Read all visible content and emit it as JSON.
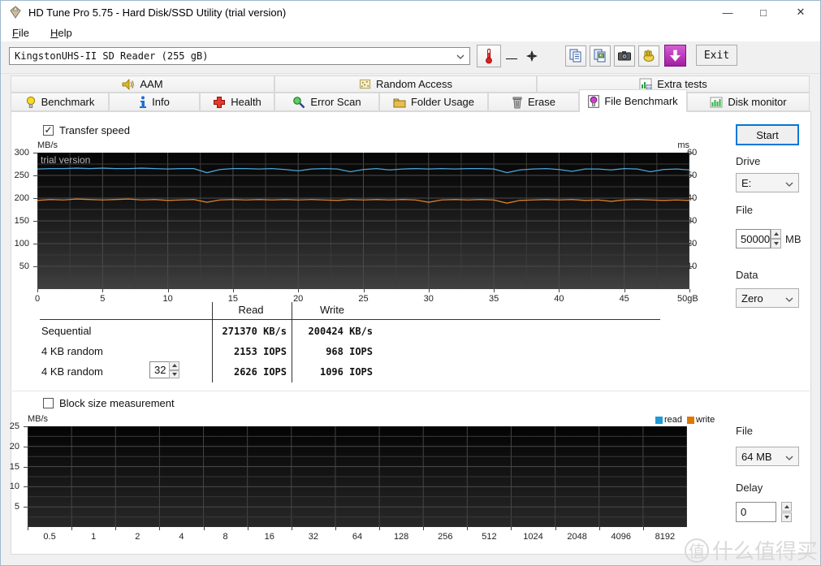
{
  "window": {
    "title": "HD Tune Pro 5.75 - Hard Disk/SSD Utility (trial version)",
    "controls": {
      "minimize": "—",
      "maximize": "□",
      "close": "✕"
    }
  },
  "menu": {
    "items": [
      {
        "label": "File"
      },
      {
        "label": "Help"
      }
    ]
  },
  "toolbar": {
    "device_select": "KingstonUHS-II SD Reader (255 gB)",
    "temperature_value": "—",
    "exit_label": "Exit"
  },
  "tabs": {
    "row1": [
      "AAM",
      "Random Access",
      "Extra tests"
    ],
    "row2": [
      "Benchmark",
      "Info",
      "Health",
      "Error Scan",
      "Folder Usage",
      "Erase",
      "File Benchmark",
      "Disk monitor"
    ],
    "selected": "File Benchmark"
  },
  "panel": {
    "transfer_speed": {
      "label": "Transfer speed",
      "checked": true
    },
    "block_size": {
      "label": "Block size measurement",
      "checked": false
    },
    "results": {
      "columns": [
        "Read",
        "Write"
      ],
      "rows": [
        {
          "label": "Sequential",
          "read": "271370 KB/s",
          "write": "200424 KB/s"
        },
        {
          "label": "4 KB random",
          "read": "2153 IOPS",
          "write": "968 IOPS"
        },
        {
          "label": "4 KB random",
          "queue_depth": "32",
          "read": "2626 IOPS",
          "write": "1096 IOPS"
        }
      ]
    },
    "legend": [
      {
        "label": "read",
        "color": "#1f9ad6"
      },
      {
        "label": "write",
        "color": "#e07800"
      }
    ]
  },
  "sidebar": {
    "start_label": "Start",
    "drive_label": "Drive",
    "drive_value": "E:",
    "file_label": "File",
    "file_size_value": "50000",
    "file_size_unit": "MB",
    "data_label": "Data",
    "data_value": "Zero",
    "file2_label": "File",
    "file2_value": "64 MB",
    "delay_label": "Delay",
    "delay_value": "0"
  },
  "watermark": {
    "badge": "值",
    "text": "什么值得买"
  },
  "chart_data": [
    {
      "type": "line",
      "title": "Transfer speed",
      "annotation": "trial version",
      "ylabel_left": "MB/s",
      "y_ticks_left": [
        300,
        250,
        200,
        150,
        100,
        50
      ],
      "ylabel_right": "ms",
      "y_ticks_right": [
        60,
        50,
        40,
        30,
        20,
        10
      ],
      "ylim_left": [
        0,
        300
      ],
      "ylim_right": [
        0,
        60
      ],
      "x_ticks": [
        "0",
        "5",
        "10",
        "15",
        "20",
        "25",
        "30",
        "35",
        "40",
        "45",
        "50gB"
      ],
      "x_range_gb": [
        0,
        50
      ],
      "grid": true,
      "series": [
        {
          "name": "read",
          "color": "#4aa6dc",
          "unit": "MB/s",
          "values": [
            264,
            265,
            265,
            266,
            265,
            266,
            265,
            265,
            266,
            265,
            264,
            265,
            265,
            256,
            263,
            265,
            265,
            264,
            265,
            263,
            260,
            264,
            265,
            264,
            258,
            263,
            265,
            262,
            264,
            265,
            264,
            265,
            264,
            265,
            265,
            264,
            256,
            262,
            264,
            265,
            263,
            259,
            264,
            264,
            262,
            265,
            264,
            258,
            263,
            264,
            262
          ]
        },
        {
          "name": "write",
          "color": "#dc7f28",
          "unit": "MB/s",
          "values": [
            195,
            197,
            196,
            198,
            197,
            196,
            197,
            198,
            196,
            197,
            195,
            196,
            197,
            191,
            196,
            197,
            196,
            197,
            196,
            197,
            196,
            197,
            196,
            195,
            197,
            196,
            197,
            196,
            197,
            196,
            191,
            196,
            197,
            196,
            197,
            196,
            189,
            195,
            196,
            197,
            196,
            197,
            195,
            196,
            193,
            196,
            197,
            196,
            195,
            196,
            195
          ]
        }
      ]
    },
    {
      "type": "line",
      "title": "Block size measurement",
      "ylabel": "MB/s",
      "y_ticks": [
        25,
        20,
        15,
        10,
        5
      ],
      "ylim": [
        0,
        25
      ],
      "x_ticks": [
        "0.5",
        "1",
        "2",
        "4",
        "8",
        "16",
        "32",
        "64",
        "128",
        "256",
        "512",
        "1024",
        "2048",
        "4096",
        "8192"
      ],
      "grid": true,
      "legend_position": "top-right",
      "series": [
        {
          "name": "read",
          "color": "#1f9ad6",
          "values": []
        },
        {
          "name": "write",
          "color": "#e07800",
          "values": []
        }
      ]
    }
  ]
}
